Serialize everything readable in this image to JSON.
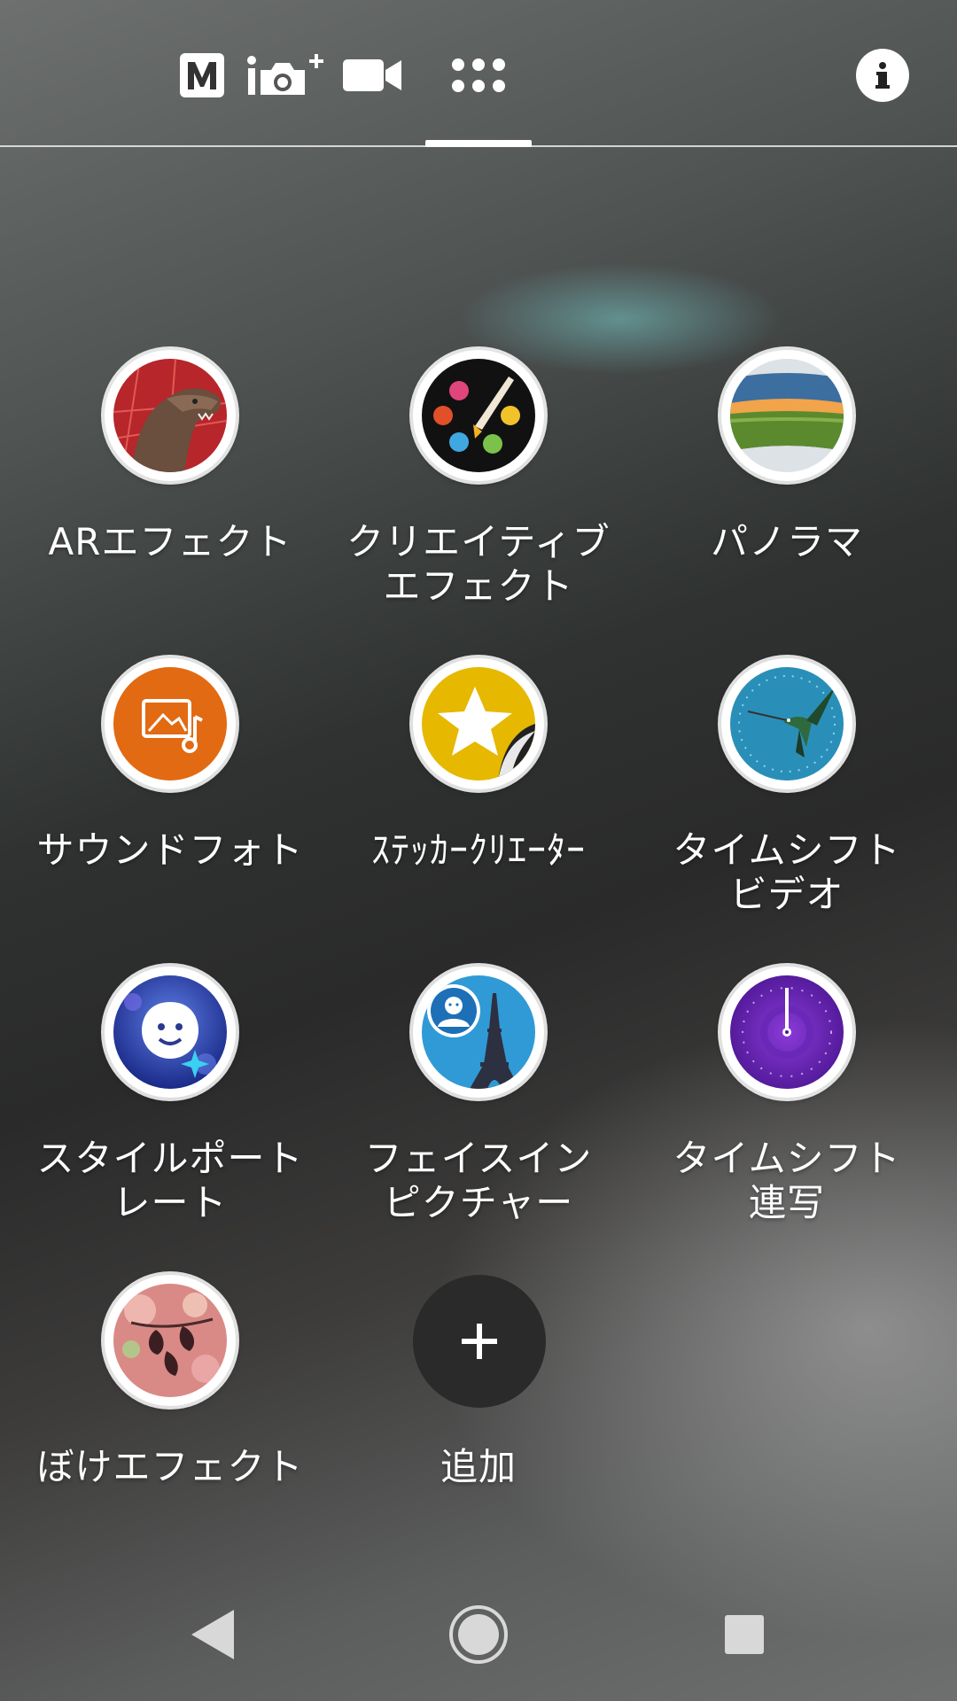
{
  "topbar": {
    "modes": [
      {
        "name": "manual-mode",
        "icon": "manual-m-icon"
      },
      {
        "name": "intelligent-auto-mode",
        "icon": "camera-plus-icon"
      },
      {
        "name": "video-mode",
        "icon": "video-camera-icon"
      },
      {
        "name": "apps-mode",
        "icon": "grid-dots-icon"
      }
    ],
    "info_icon": "info-icon"
  },
  "apps": [
    {
      "label": "ARエフェクト",
      "icon": "ar-effect-dinosaur-icon"
    },
    {
      "label": "クリエイティブ\nエフェクト",
      "icon": "creative-effect-palette-icon"
    },
    {
      "label": "パノラマ",
      "icon": "panorama-landscape-icon"
    },
    {
      "label": "サウンドフォト",
      "icon": "sound-photo-icon"
    },
    {
      "label": "ｽﾃｯｶｰｸﾘｴｰﾀｰ",
      "icon": "sticker-creator-star-icon"
    },
    {
      "label": "タイムシフト\nビデオ",
      "icon": "timeshift-video-hummingbird-icon"
    },
    {
      "label": "スタイルポート\nレート",
      "icon": "style-portrait-face-icon"
    },
    {
      "label": "フェイスイン\nピクチャー",
      "icon": "face-in-picture-eiffel-icon"
    },
    {
      "label": "タイムシフト\n連写",
      "icon": "timeshift-burst-clock-icon"
    },
    {
      "label": "ぼけエフェクト",
      "icon": "bokeh-effect-leaves-icon"
    },
    {
      "label": "追加",
      "icon": "plus-icon"
    }
  ],
  "navbar": {
    "back": "back-triangle-icon",
    "home": "home-circle-icon",
    "recents": "recents-square-icon"
  }
}
